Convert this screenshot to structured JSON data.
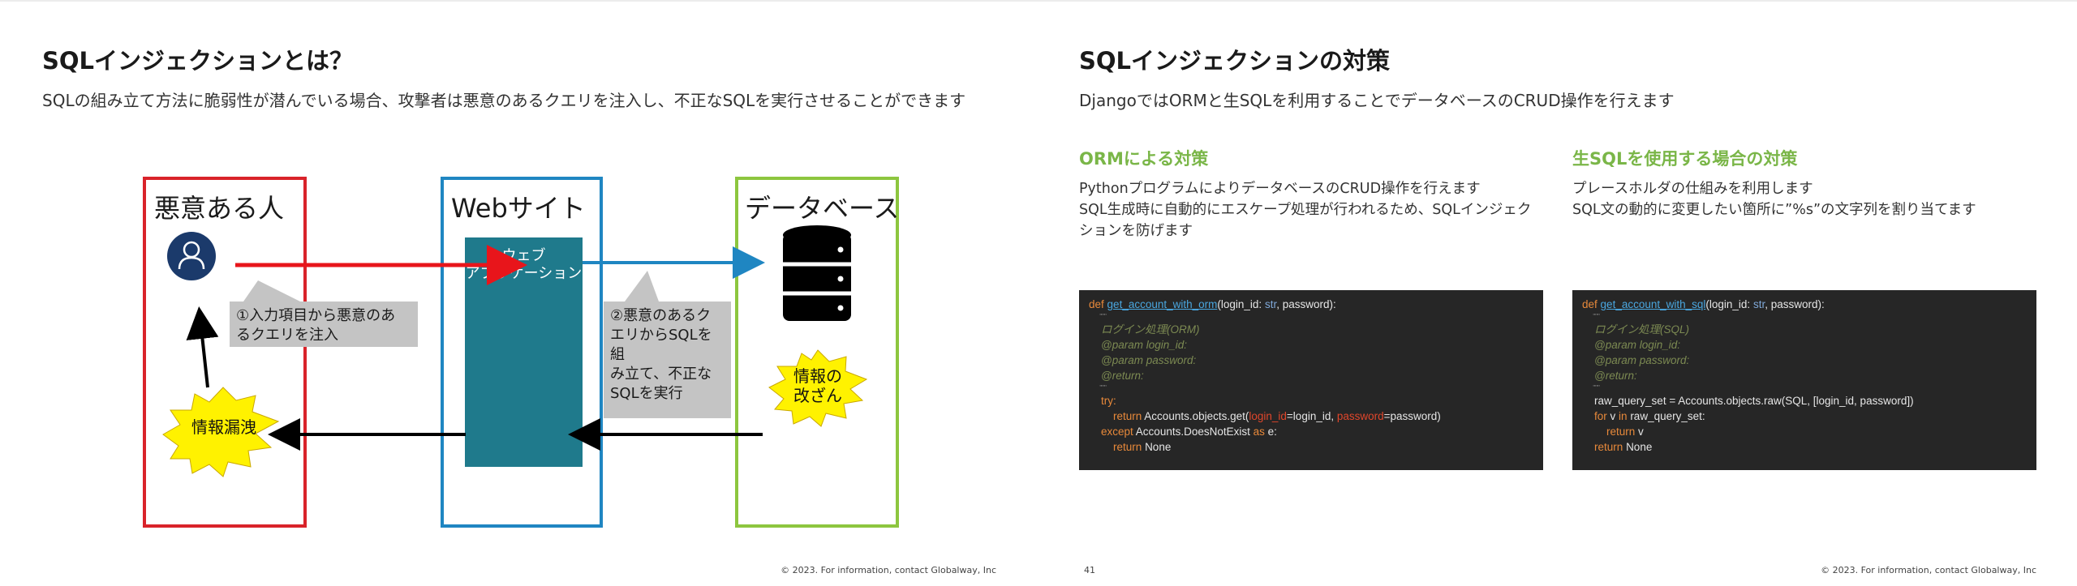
{
  "left_slide": {
    "title": "SQLインジェクションとは？",
    "subtitle": "SQLの組み立て方法に脆弱性が潜んでいる場合、攻撃者は悪意のあるクエリを注入し、不正なSQLを実行させることができます",
    "footer": "© 2023. For information, contact Globalway, Inc",
    "diagram": {
      "attacker_label": "悪意ある人",
      "website_label": "Webサイト",
      "database_label": "データベース",
      "webapp_lines": [
        "ウェブ",
        "アプリケーション"
      ],
      "callout1_lines": [
        "①入力項目から悪意のあ",
        "るクエリを注入"
      ],
      "callout2_lines": [
        "②悪意のあるク",
        "エリからSQLを組",
        "み立て、不正な",
        "SQLを実行"
      ],
      "leak_label": "情報漏洩",
      "tamper_lines": [
        "情報の",
        "改ざん"
      ],
      "colors": {
        "attacker_border": "#d9232a",
        "website_border": "#1f86c2",
        "database_border": "#8dc63f",
        "red_arrow": "#e8151b",
        "blue_arrow": "#1f86c2",
        "burst_fill": "#fff200",
        "webapp_fill": "#1f7a8c",
        "user_icon": "#1b3a6b"
      }
    }
  },
  "right_slide": {
    "title": "SQLインジェクションの対策",
    "subtitle": "DjangoではORMと生SQLを利用することでデータベースのCRUD操作を行えます",
    "left_col": {
      "heading": "ORMによる対策",
      "lines": [
        "PythonプログラムによりデータベースのCRUD操作を行えます",
        "SQL生成時に自動的にエスケープ処理が行われるため、SQLインジェク",
        "ションを防げます"
      ]
    },
    "right_col": {
      "heading": "生SQLを使用する場合の対策",
      "lines": [
        "プレースホルダの仕組みを利用します",
        "SQL文の動的に変更したい箇所に”%s”の文字列を割り当てます"
      ]
    },
    "code_orm": {
      "def_kw": "def",
      "fn_name": "get_account_with_orm",
      "sig_a": "(login_id: ",
      "sig_type": "str",
      "sig_b": ", password):",
      "docquote": "\"\"\"",
      "doc_lines": [
        "ログイン処理(ORM)",
        "@param login_id:",
        "@param password:",
        "@return:"
      ],
      "try_kw": "try:",
      "return_kw": "return",
      "call_a": " Accounts.objects.get(",
      "arg1": "login_id",
      "call_b": "=login_id, ",
      "arg2": "password",
      "call_c": "=password)",
      "except_kw": "except",
      "except_a": " Accounts.DoesNotExist ",
      "as_kw": "as",
      "except_b": " e:",
      "none_text": "None"
    },
    "code_sql": {
      "def_kw": "def",
      "fn_name": "get_account_with_sql",
      "sig_a": "(login_id: ",
      "sig_type": "str",
      "sig_b": ", password):",
      "docquote": "\"\"\"",
      "doc_lines": [
        "ログイン処理(SQL)",
        "@param login_id:",
        "@param password:",
        "@return:"
      ],
      "raw_line": "raw_query_set = Accounts.objects.raw(SQL, [login_id, password])",
      "for_kw": "for",
      "for_a": " v ",
      "in_kw": "in",
      "for_b": " raw_query_set:",
      "return_kw": "return",
      "return_v": " v",
      "none_text": "None"
    },
    "page_number": "41",
    "footer": "© 2023. For information, contact Globalway, Inc"
  }
}
